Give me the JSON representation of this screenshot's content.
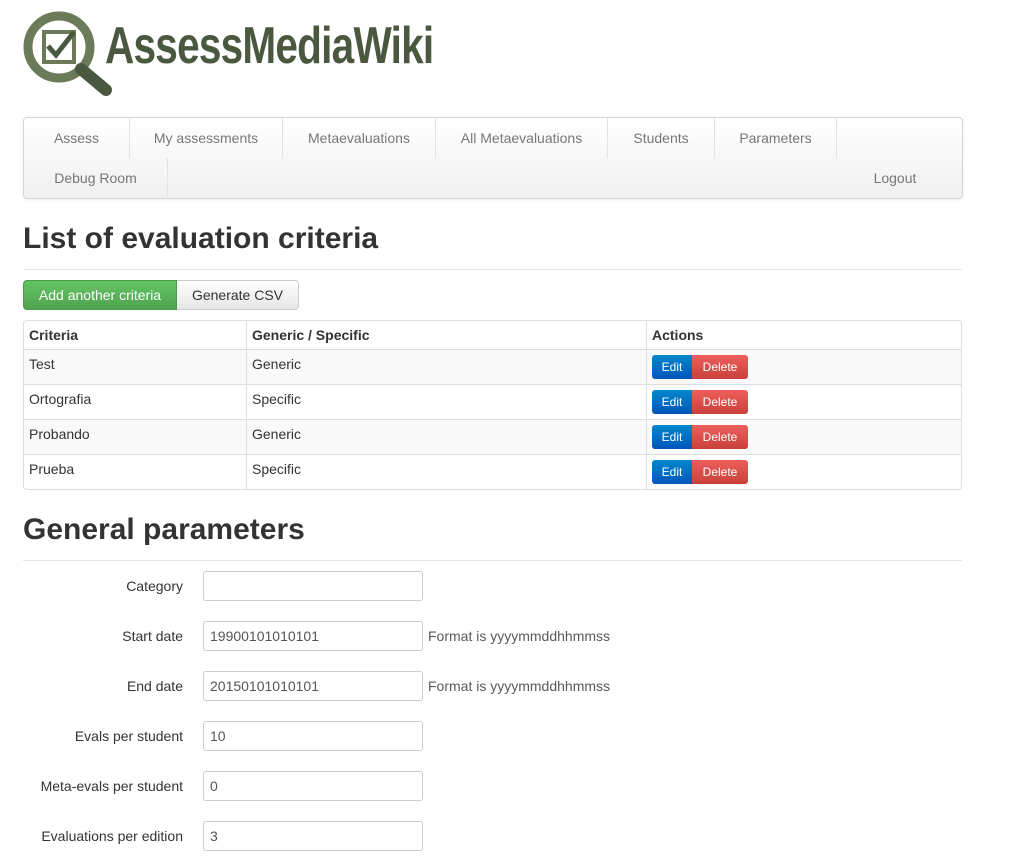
{
  "logo": {
    "text": "AssessMediaWiki"
  },
  "nav": {
    "items": [
      "Assess",
      "My assessments",
      "Metaevaluations",
      "All Metaevaluations",
      "Students",
      "Parameters",
      "Debug Room"
    ],
    "logout": "Logout"
  },
  "criteria_section": {
    "title": "List of evaluation criteria",
    "add_button": "Add another criteria",
    "csv_button": "Generate CSV",
    "columns": [
      "Criteria",
      "Generic / Specific",
      "Actions"
    ],
    "rows": [
      {
        "criteria": "Test",
        "type": "Generic"
      },
      {
        "criteria": "Ortografia",
        "type": "Specific"
      },
      {
        "criteria": "Probando",
        "type": "Generic"
      },
      {
        "criteria": "Prueba",
        "type": "Specific"
      }
    ],
    "edit_label": "Edit",
    "delete_label": "Delete"
  },
  "params_section": {
    "title": "General parameters",
    "fields": [
      {
        "label": "Category",
        "value": "",
        "help": ""
      },
      {
        "label": "Start date",
        "value": "19900101010101",
        "help": "Format is yyyymmddhhmmss"
      },
      {
        "label": "End date",
        "value": "20150101010101",
        "help": "Format is yyyymmddhhmmss"
      },
      {
        "label": "Evals per student",
        "value": "10",
        "help": ""
      },
      {
        "label": "Meta-evals per student",
        "value": "0",
        "help": ""
      },
      {
        "label": "Evaluations per edition",
        "value": "3",
        "help": ""
      }
    ]
  },
  "colors": {
    "logo_green": "#4b5840",
    "success": "#5bb75b",
    "primary": "#0074cc",
    "danger": "#da4f49"
  }
}
